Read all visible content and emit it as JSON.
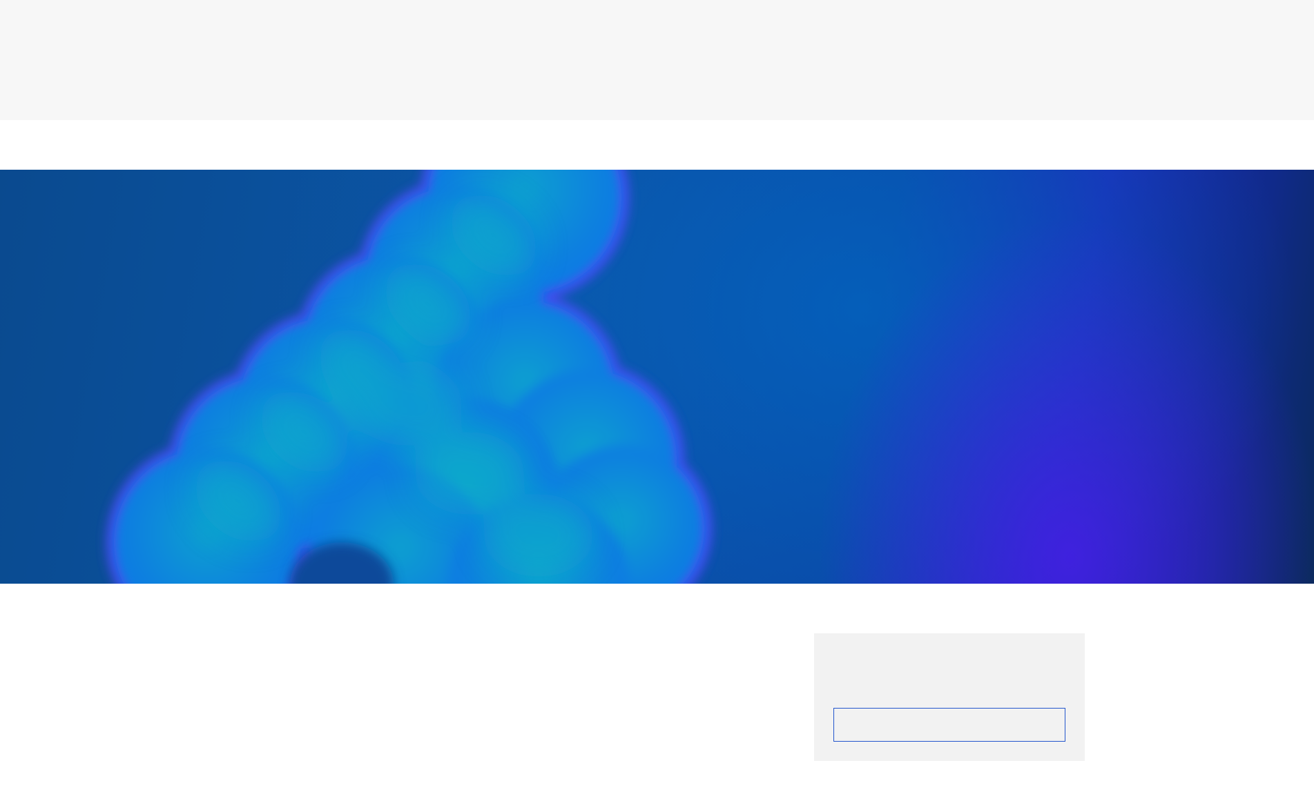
{
  "header": {
    "background_color": "#f7f7f7"
  },
  "hero": {
    "image": "abstract-blue-bubbles",
    "colors": {
      "base": "#0b56a8",
      "bubble": "#0a7fe0",
      "bubble_outline": "#5544ff",
      "accent": "#3b1fe0"
    }
  },
  "sidebar_panel": {
    "background_color": "#f2f2f2",
    "input": {
      "value": "",
      "placeholder": "",
      "border_color": "#2255cc"
    }
  }
}
